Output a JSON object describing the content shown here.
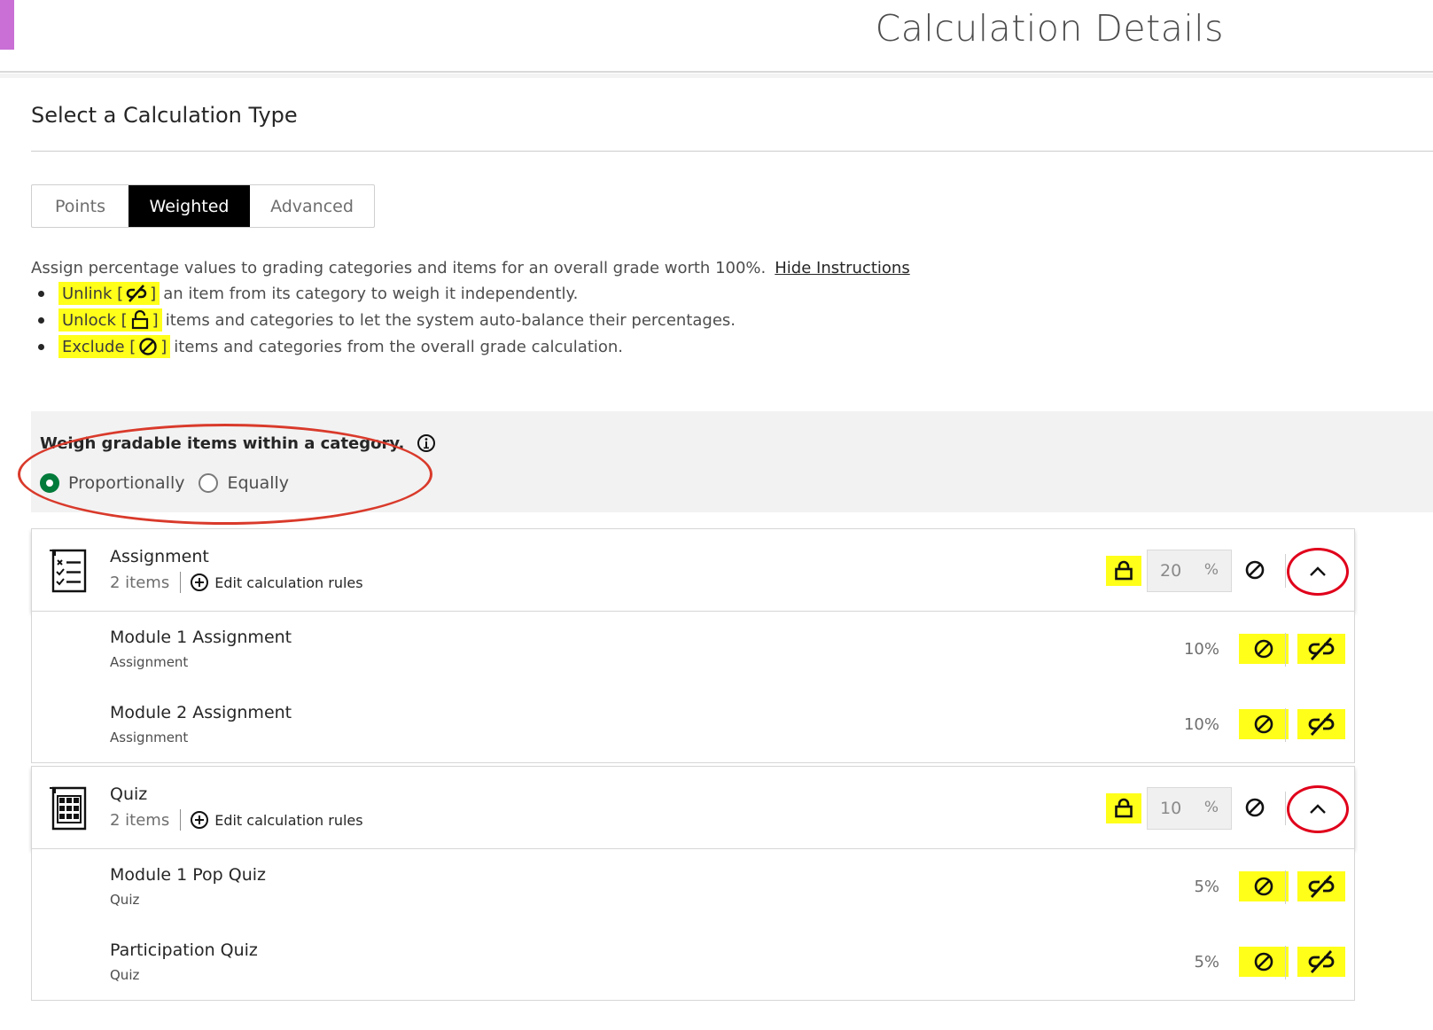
{
  "colors": {
    "accent_bar": "#c96fd6",
    "highlight": "#ffff1a",
    "annotation_red": "#e0001b",
    "radio_selected": "#037b3b"
  },
  "header": {
    "title": "Calculation Details"
  },
  "calc_type": {
    "title": "Select a Calculation Type",
    "options": [
      "Points",
      "Weighted",
      "Advanced"
    ],
    "selected": "Weighted"
  },
  "instructions": {
    "text": "Assign percentage values to grading categories and items for an overall grade worth 100%.",
    "hide_link": "Hide Instructions",
    "bullets": [
      {
        "label": "Unlink [",
        "close": "]",
        "icon": "unlink-icon",
        "rest": "an item from its category to weigh it independently."
      },
      {
        "label": "Unlock [",
        "close": "]",
        "icon": "unlock-icon",
        "rest": "items and categories to let the system auto-balance their percentages."
      },
      {
        "label": "Exclude [",
        "close": "]",
        "icon": "exclude-icon",
        "rest": "items and categories from the overall grade calculation."
      }
    ]
  },
  "weigh": {
    "title": "Weigh gradable items within a category.",
    "options": [
      "Proportionally",
      "Equally"
    ],
    "selected": "Proportionally"
  },
  "categories": [
    {
      "name": "Assignment",
      "items_count": "2 items",
      "edit_label": "Edit calculation rules",
      "percent": "20",
      "percent_symbol": "%",
      "icon": "checklist-icon",
      "items": [
        {
          "name": "Module 1 Assignment",
          "type": "Assignment",
          "percent": "10%"
        },
        {
          "name": "Module 2 Assignment",
          "type": "Assignment",
          "percent": "10%"
        }
      ]
    },
    {
      "name": "Quiz",
      "items_count": "2 items",
      "edit_label": "Edit calculation rules",
      "percent": "10",
      "percent_symbol": "%",
      "icon": "quiz-grid-icon",
      "items": [
        {
          "name": "Module 1 Pop Quiz",
          "type": "Quiz",
          "percent": "5%"
        },
        {
          "name": "Participation Quiz",
          "type": "Quiz",
          "percent": "5%"
        }
      ]
    }
  ]
}
